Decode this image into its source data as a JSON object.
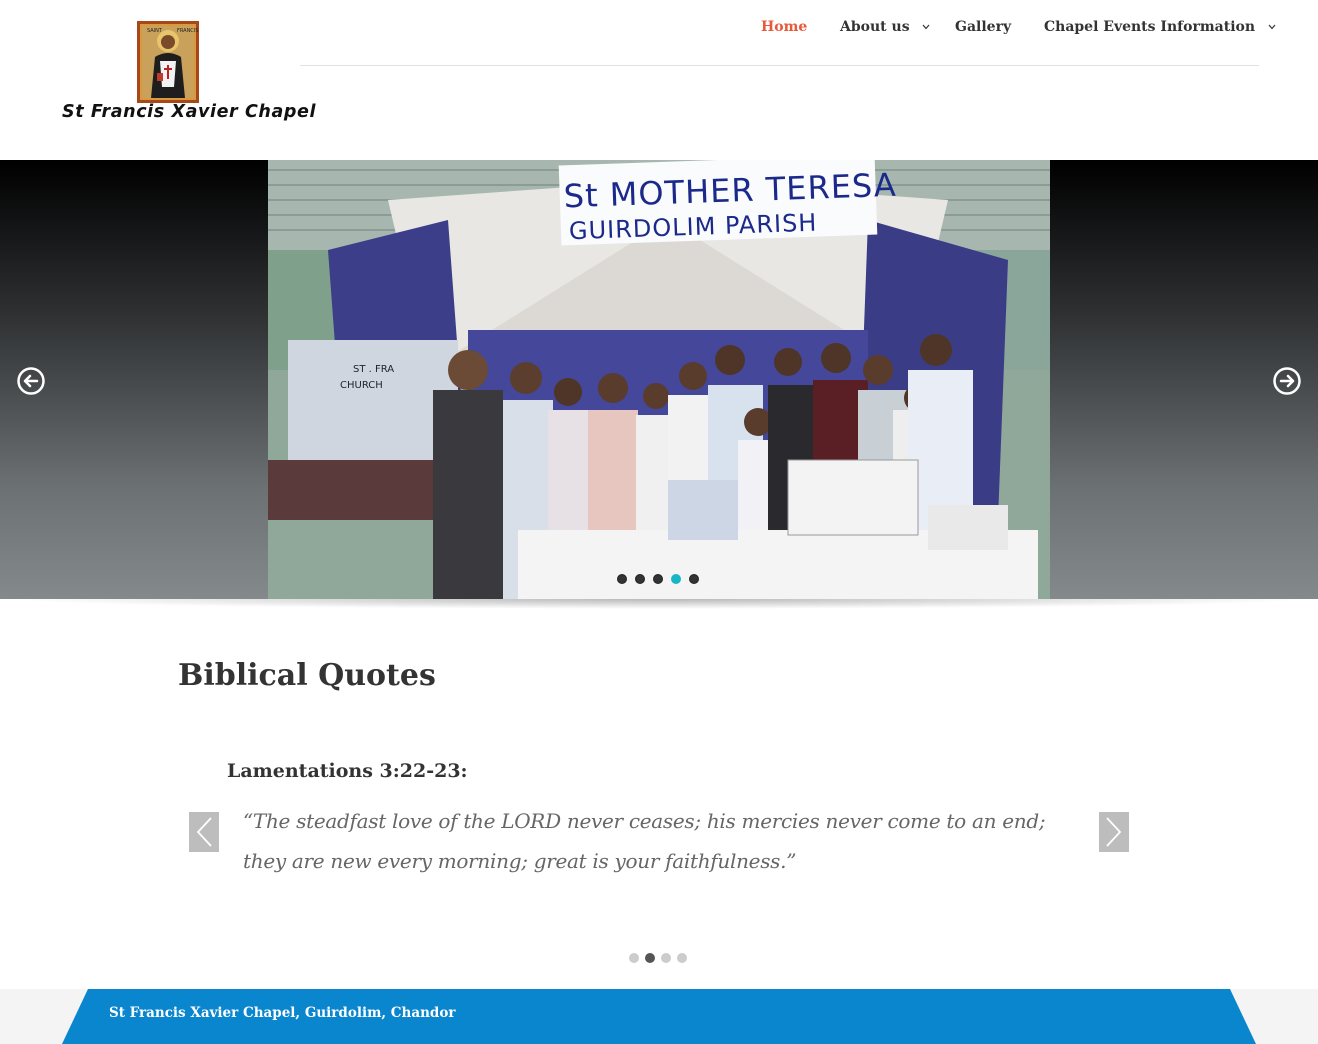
{
  "logo": {
    "text": "St Francis Xavier Chapel",
    "icon": "saint-icon"
  },
  "nav": {
    "items": [
      {
        "label": "Home",
        "active": true
      },
      {
        "label": "About us",
        "has_dropdown": true
      },
      {
        "label": "Gallery"
      },
      {
        "label": "Chapel Events Information",
        "has_dropdown": true
      }
    ]
  },
  "slider": {
    "banner_line1": "St MOTHER TERESA",
    "banner_line2": "GUIRDOLIM   PARISH",
    "prev_icon": "arrow-left-circle-icon",
    "next_icon": "arrow-right-circle-icon",
    "slide_count": 5,
    "active_slide": 4,
    "active_color": "#17b6c4"
  },
  "quotes": {
    "title": "Biblical Quotes",
    "reference": "Lamentations 3:22-23:",
    "text": "“The steadfast love of the LORD never ceases; his mercies never come to an end; they are new every morning; great is your faithfulness.”",
    "slide_count": 4,
    "active_slide": 2
  },
  "footer": {
    "text": "St Francis Xavier Chapel, Guirdolim, Chandor",
    "color": "#0a86cf"
  },
  "colors": {
    "accent": "#e8583a",
    "heading": "#333333",
    "quote_text": "#666666"
  }
}
